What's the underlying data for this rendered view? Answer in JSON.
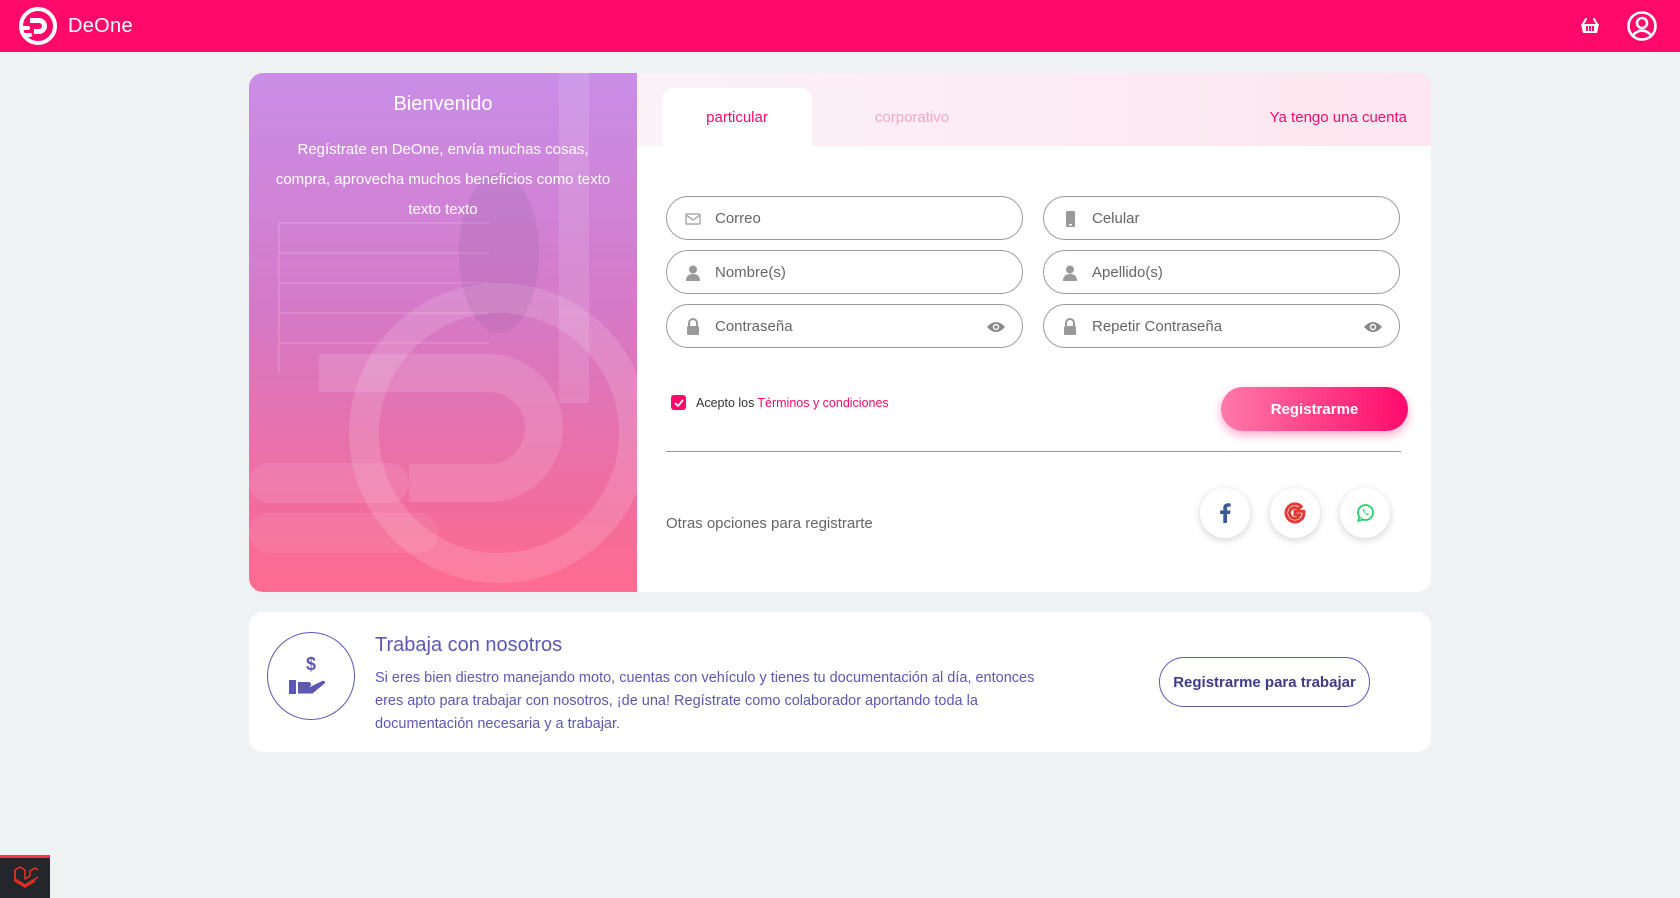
{
  "app": {
    "brand": "DeOne"
  },
  "colors": {
    "primary": "#ff0a6b",
    "accent": "#5e57b6",
    "page_bg": "#eff2f3"
  },
  "header": {
    "icons": [
      "cart-basket-icon",
      "user-account-icon"
    ]
  },
  "hero": {
    "title": "Bienvenido",
    "text": "Regístrate en DeOne, envía muchas cosas, compra, aprovecha muchos beneficios como texto texto texto"
  },
  "tabs": {
    "active": "particular",
    "inactive": "corporativo",
    "login_link": "Ya tengo una cuenta"
  },
  "form": {
    "email_placeholder": "Correo",
    "phone_placeholder": "Celular",
    "first_name_placeholder": "Nombre(s)",
    "last_name_placeholder": "Apellido(s)",
    "password_placeholder": "Contraseña",
    "repeat_password_placeholder": "Repetir Contraseña",
    "terms_prefix": "Acepto los",
    "terms_link": "Términos y condiciones",
    "terms_checked": true,
    "submit_label": "Registrarme"
  },
  "social": {
    "label": "Otras opciones para registrarte",
    "options": [
      "facebook-icon",
      "google-icon",
      "whatsapp-icon"
    ]
  },
  "work": {
    "title": "Trabaja con nosotros",
    "text": "Si eres bien diestro manejando moto, cuentas con vehículo y tienes tu documentación al día, entonces eres apto para trabajar con nosotros, ¡de una! Regístrate como colaborador aportando toda la documentación necesaria y a trabajar.",
    "button_label": "Registrarme para trabajar",
    "icon": "hand-money-icon"
  }
}
